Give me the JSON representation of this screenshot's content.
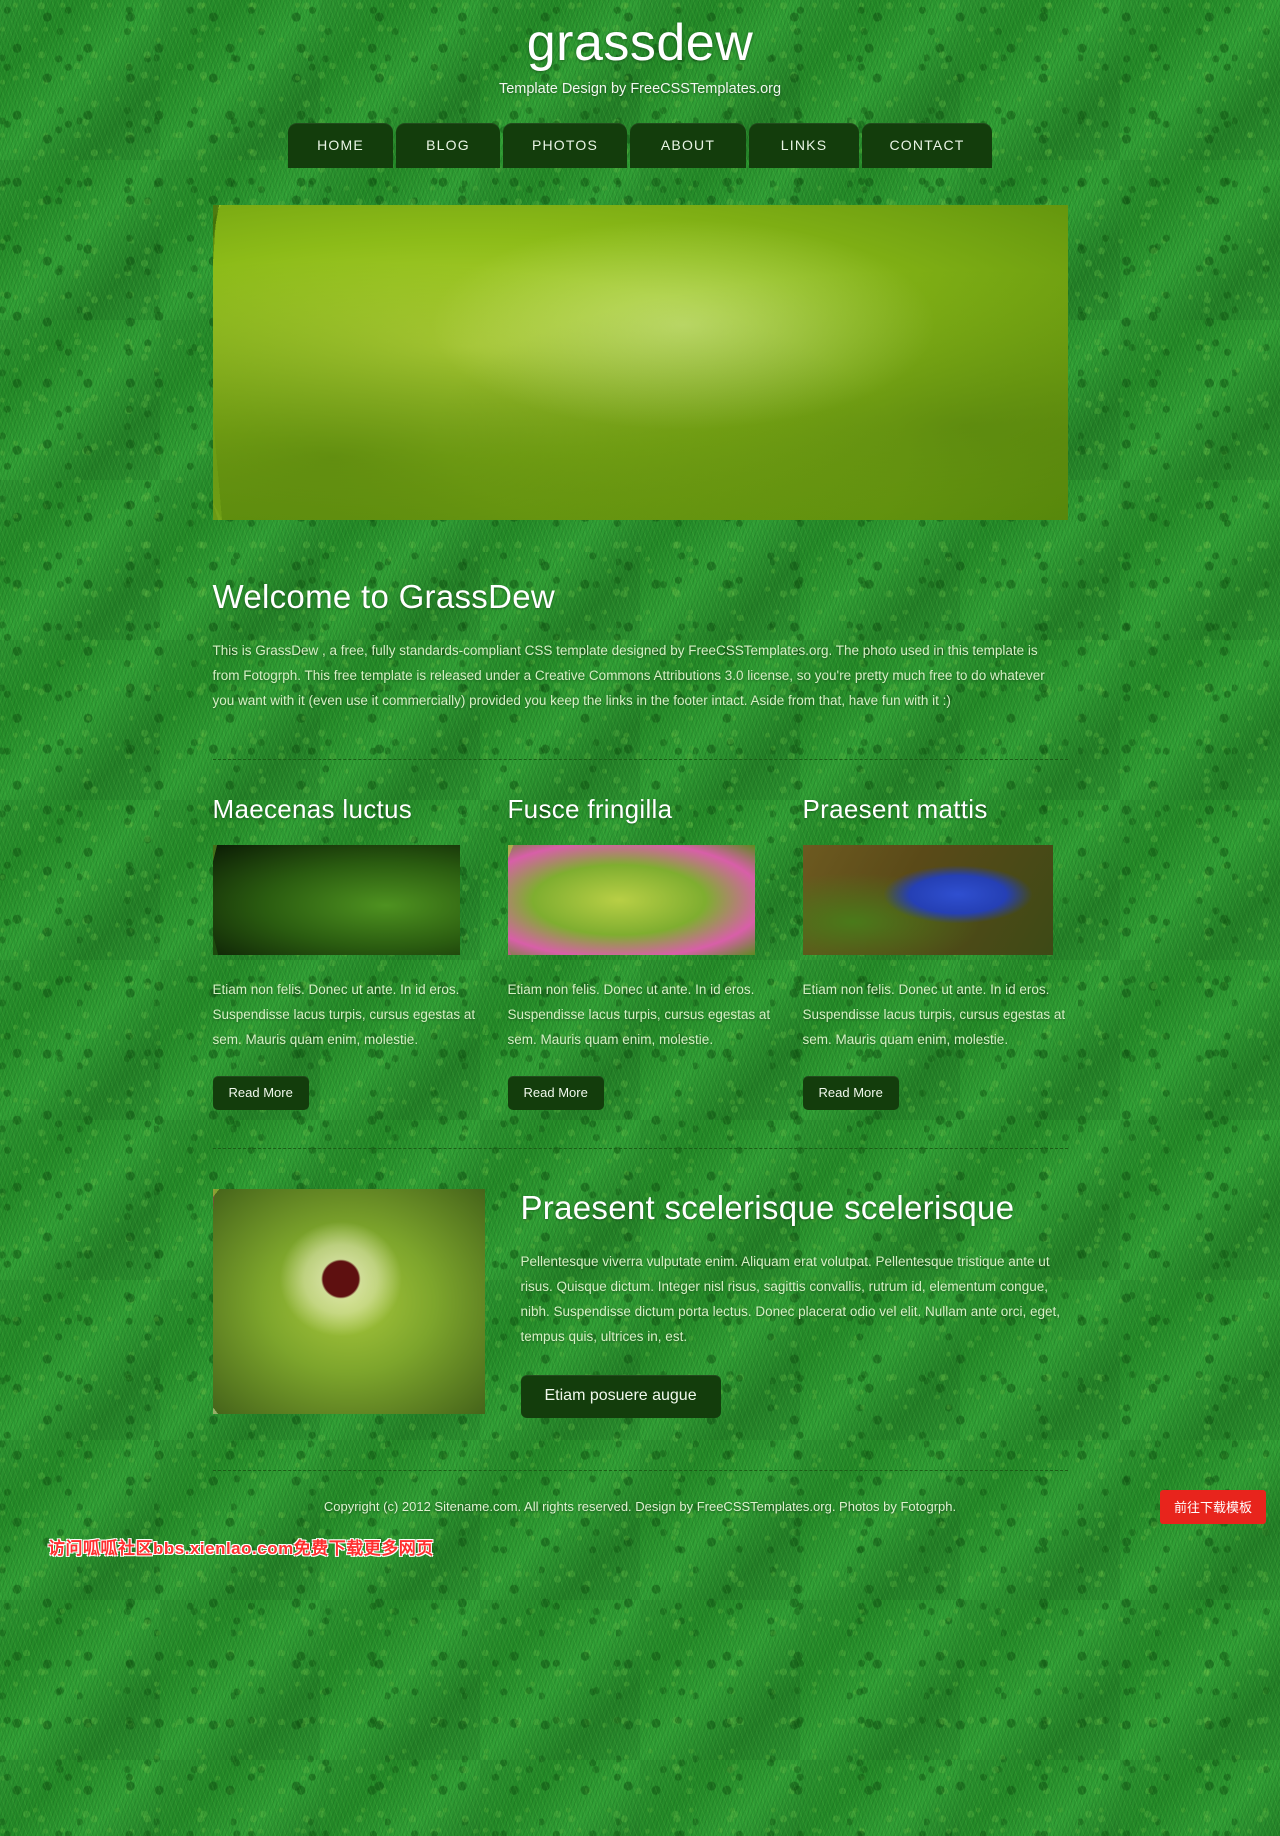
{
  "header": {
    "title": "grassdew",
    "tagline": "Template Design by FreeCSSTemplates.org"
  },
  "nav": {
    "items": [
      {
        "label": "HOME",
        "key": "home"
      },
      {
        "label": "BLOG",
        "key": "blog"
      },
      {
        "label": "PHOTOS",
        "key": "photos"
      },
      {
        "label": "ABOUT",
        "key": "about"
      },
      {
        "label": "LINKS",
        "key": "links"
      },
      {
        "label": "CONTACT",
        "key": "contact"
      }
    ]
  },
  "banner": {
    "alt": "close-up photo of green grass blades"
  },
  "welcome": {
    "title": "Welcome to GrassDew",
    "paragraph": "This is GrassDew , a free, fully standards-compliant CSS template designed by FreeCSSTemplates.org. The photo used in this template is from Fotogrph. This free template is released under a Creative Commons Attributions 3.0 license, so you're pretty much free to do whatever you want with it (even use it commercially) provided you keep the links in the footer intact. Aside from that, have fun with it :)"
  },
  "features": [
    {
      "title": "Maecenas luctus",
      "body": "Etiam non felis. Donec ut ante. In id eros. Suspendisse lacus turpis, cursus egestas at sem. Mauris quam enim, molestie.",
      "button": "Read More",
      "thumb_alt": "green fern leaves photo"
    },
    {
      "title": "Fusce fringilla",
      "body": "Etiam non felis. Donec ut ante. In id eros. Suspendisse lacus turpis, cursus egestas at sem. Mauris quam enim, molestie.",
      "button": "Read More",
      "thumb_alt": "pink and green variegated leaves photo"
    },
    {
      "title": "Praesent mattis",
      "body": "Etiam non felis. Donec ut ante. In id eros. Suspendisse lacus turpis, cursus egestas at sem. Mauris quam enim, molestie.",
      "button": "Read More",
      "thumb_alt": "blue flower photo"
    }
  ],
  "promo": {
    "title": "Praesent scelerisque scelerisque",
    "paragraph": "Pellentesque viverra vulputate enim. Aliquam erat volutpat. Pellentesque tristique ante ut risus. Quisque dictum. Integer nisl risus, sagittis convallis, rutrum id, elementum congue, nibh. Suspendisse dictum porta lectus. Donec placerat odio vel elit. Nullam ante orci, eget, tempus quis, ultrices in, est.",
    "button": "Etiam posuere augue",
    "thumb_alt": "thistle flower close-up photo"
  },
  "footer": {
    "text": "Copyright (c) 2012 Sitename.com. All rights reserved. Design by FreeCSSTemplates.org. Photos by Fotogrph."
  },
  "overlays": {
    "download_button": "前往下载模板",
    "watermark": "访问呱呱社区bbs.xienlao.com免费下载更多网页",
    "accent_red": "#e8241c",
    "nav_dark_green": "#133d0c",
    "page_green": "#2b9130"
  }
}
